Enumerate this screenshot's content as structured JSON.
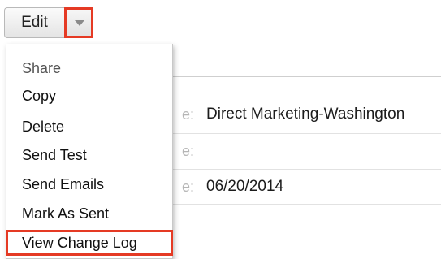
{
  "toolbar": {
    "edit_label": "Edit",
    "dropdown_toggle_icon": "caret-down-icon",
    "highlight_color": "#e53a24"
  },
  "actions_menu": {
    "items": [
      {
        "label": "Share",
        "state": "disabled"
      },
      {
        "label": "Copy"
      },
      {
        "label": "Delete"
      },
      {
        "label": "Send Test"
      },
      {
        "label": "Send Emails"
      },
      {
        "label": "Mark As Sent"
      },
      {
        "label": "View Change Log",
        "highlighted": true
      }
    ]
  },
  "record": {
    "fields": [
      {
        "label_fragment": "e:",
        "value": "Direct Marketing-Washington"
      },
      {
        "label_fragment": "e:",
        "value": ""
      },
      {
        "label_fragment": "e:",
        "value": "06/20/2014"
      }
    ]
  }
}
